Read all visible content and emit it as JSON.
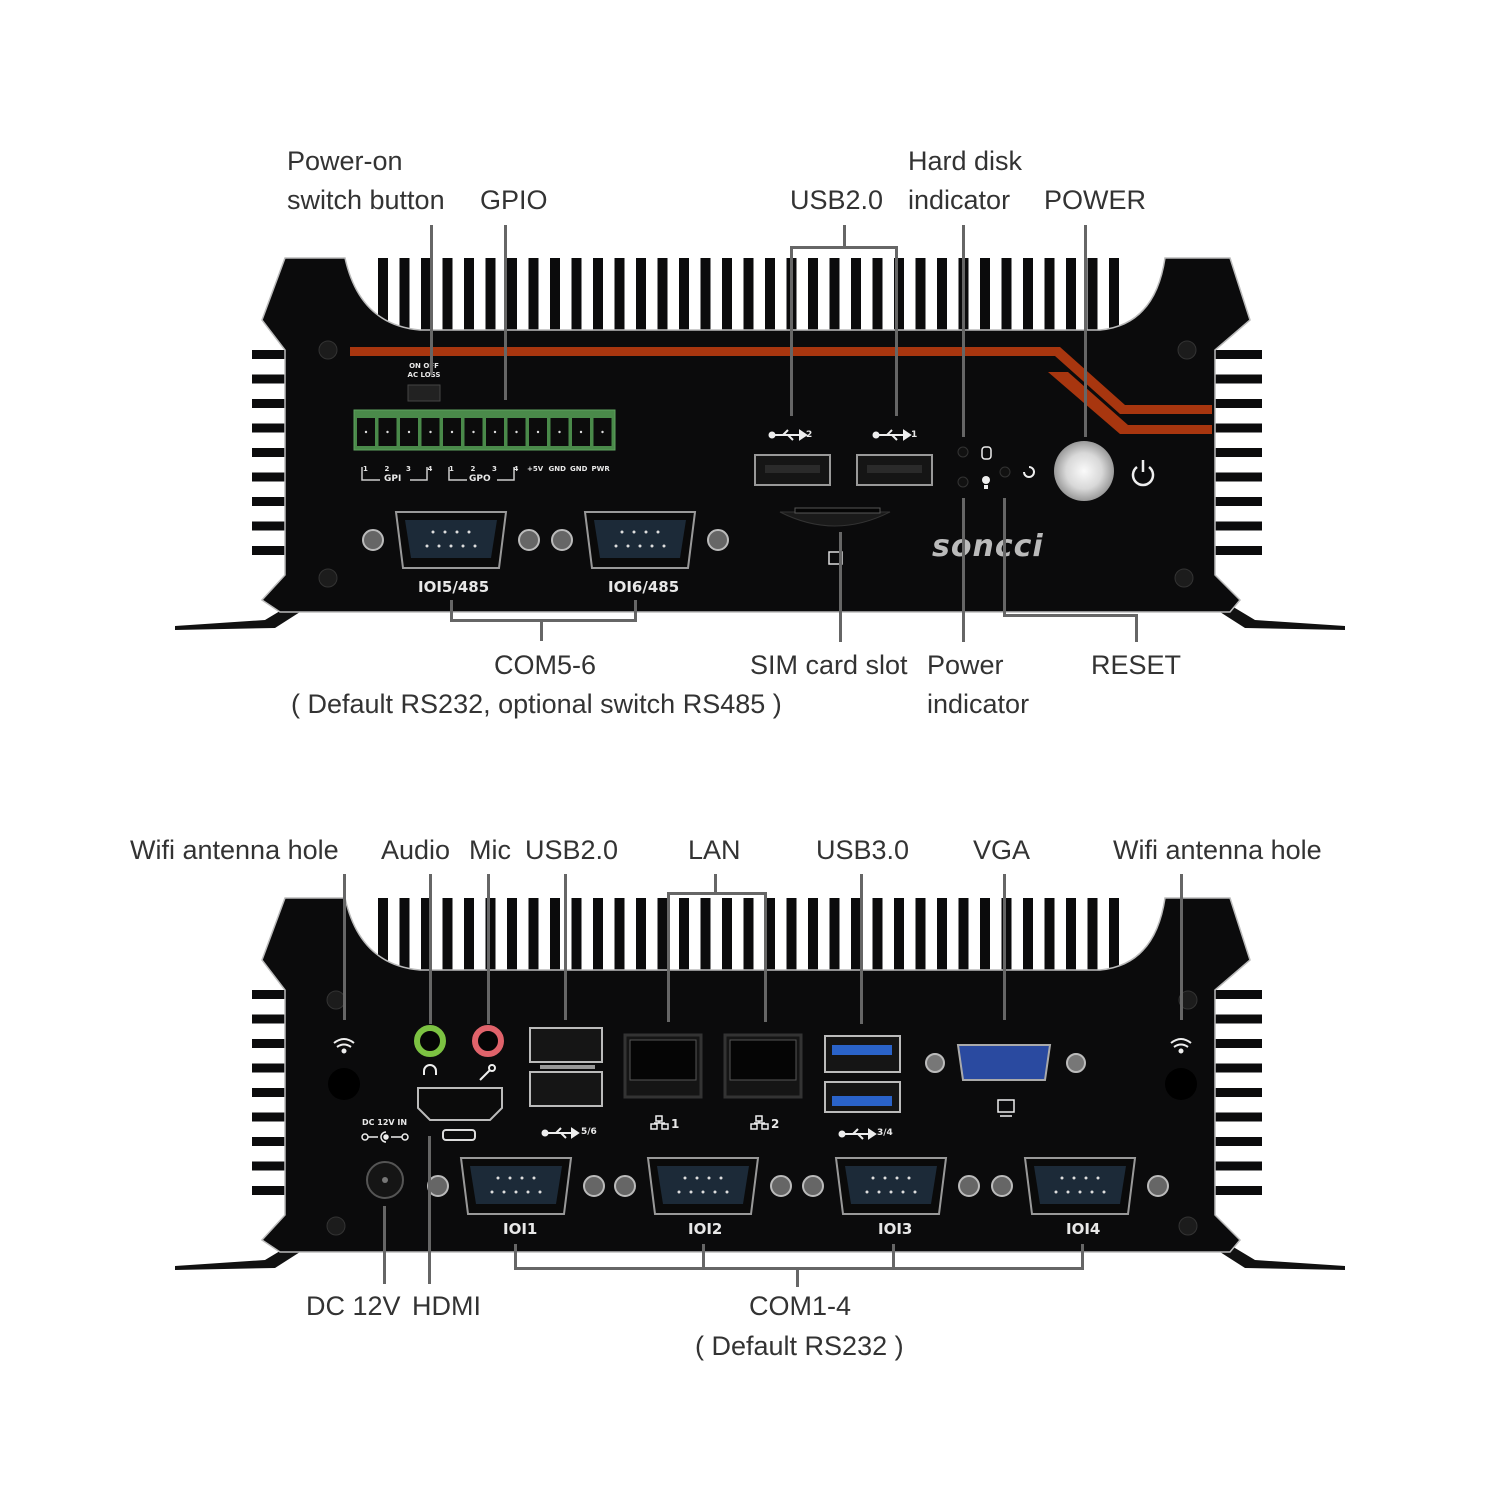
{
  "brand": "soncci",
  "front_panel": {
    "labels": {
      "power_switch": [
        "Power-on",
        "switch button"
      ],
      "gpio": "GPIO",
      "usb2": "USB2.0",
      "hdd_indicator": [
        "Hard disk",
        "indicator"
      ],
      "power": "POWER",
      "com56": "COM5-6",
      "com56_note": "( Default RS232, optional switch RS485 )",
      "sim": "SIM card slot",
      "power_indicator": [
        "Power",
        "indicator"
      ],
      "reset": "RESET"
    },
    "switch_text": [
      "ON  OFF",
      "AC LOSS"
    ],
    "gpio_pins": [
      "1",
      "2",
      "3",
      "4",
      "1",
      "2",
      "3",
      "4",
      "+5V",
      "GND",
      "GND",
      "PWR"
    ],
    "gpio_groups": [
      "GPI",
      "GPO"
    ],
    "usb_ports": [
      "2",
      "1"
    ],
    "com_ports": [
      "IOI5/485",
      "IOI6/485"
    ],
    "accent_color": "#a8360f"
  },
  "rear_panel": {
    "labels": {
      "wifi_left": "Wifi antenna hole",
      "audio": "Audio",
      "mic": "Mic",
      "usb2": "USB2.0",
      "lan": "LAN",
      "usb3": "USB3.0",
      "vga": "VGA",
      "wifi_right": "Wifi antenna hole",
      "dc": "DC 12V",
      "hdmi": "HDMI",
      "com14": "COM1-4",
      "com14_note": "( Default RS232 )"
    },
    "dc_text": "DC 12V IN",
    "usb2_ports": "5/6",
    "usb3_ports": "3/4",
    "lan_ports": [
      "1",
      "2"
    ],
    "com_ports": [
      "IOI1",
      "IOI2",
      "IOI3",
      "IOI4"
    ],
    "audio_color": "#7cc242",
    "mic_color": "#e0636b",
    "usb3_color": "#2a63c9",
    "vga_color": "#2a4aa0"
  }
}
